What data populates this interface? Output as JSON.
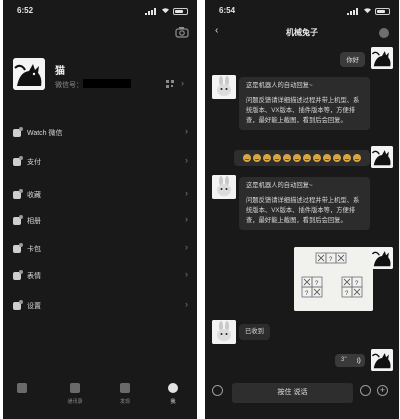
{
  "left": {
    "status": {
      "time": "6:52"
    },
    "profile": {
      "name": "猫",
      "id_label": "微信号："
    },
    "menu": [
      {
        "label": "Watch 微信",
        "icon": "watch-icon"
      },
      {
        "label": "支付",
        "icon": "payment-icon"
      },
      {
        "label": "收藏",
        "icon": "favorites-icon"
      },
      {
        "label": "相册",
        "icon": "album-icon"
      },
      {
        "label": "卡包",
        "icon": "card-icon"
      },
      {
        "label": "表情",
        "icon": "sticker-icon"
      },
      {
        "label": "设置",
        "icon": "settings-icon"
      }
    ],
    "tabs": [
      {
        "label": "",
        "icon": "chats-icon"
      },
      {
        "label": "通讯录",
        "icon": "contacts-icon"
      },
      {
        "label": "发现",
        "icon": "discover-icon"
      },
      {
        "label": "我",
        "icon": "me-icon"
      }
    ]
  },
  "right": {
    "status": {
      "time": "6:54"
    },
    "title": "机械兔子",
    "messages": {
      "hello": "你好",
      "auto1_line1": "这是机器人的自动回复~",
      "auto1_body": "问题反馈请详细描述过程并带上机型、系统版本、VX版本、插件版本等，方便排查，最好能上截图，看到后会回复。",
      "auto2_line1": "这是机器人的自动回复~",
      "auto2_body": "问题反馈请详细描述过程并带上机型、系统版本、VX版本、插件版本等，方便排查，最好能上截图，看到后会回复。",
      "received": "已收到",
      "voice_duration": "3''"
    },
    "input": {
      "hold_to_talk": "按住 说话"
    }
  },
  "colors": {
    "background": "#191919",
    "bubble_in": "#2c2c2c",
    "bubble_out": "#3a3a3a"
  }
}
